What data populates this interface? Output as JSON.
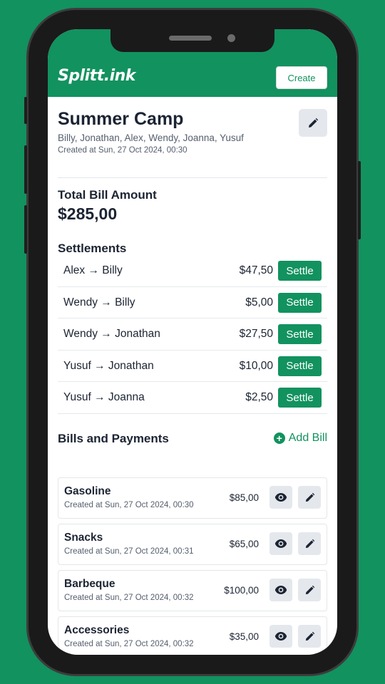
{
  "app": {
    "logo": "Splitt.ink",
    "create_label": "Create"
  },
  "group": {
    "title": "Summer Camp",
    "members": "Billy, Jonathan, Alex, Wendy, Joanna, Yusuf",
    "created": "Created at Sun, 27 Oct 2024, 00:30"
  },
  "total": {
    "label": "Total Bill Amount",
    "amount": "$285,00"
  },
  "settlements": {
    "heading": "Settlements",
    "button_label": "Settle",
    "arrow": "→",
    "items": [
      {
        "from": "Alex",
        "to": "Billy",
        "amount": "$47,50"
      },
      {
        "from": "Wendy",
        "to": "Billy",
        "amount": "$5,00"
      },
      {
        "from": "Wendy",
        "to": "Jonathan",
        "amount": "$27,50"
      },
      {
        "from": "Yusuf",
        "to": "Jonathan",
        "amount": "$10,00"
      },
      {
        "from": "Yusuf",
        "to": "Joanna",
        "amount": "$2,50"
      }
    ]
  },
  "bills": {
    "heading": "Bills and Payments",
    "add_label": "Add Bill",
    "items": [
      {
        "name": "Gasoline",
        "created": "Created at Sun, 27 Oct 2024, 00:30",
        "amount": "$85,00"
      },
      {
        "name": "Snacks",
        "created": "Created at Sun, 27 Oct 2024, 00:31",
        "amount": "$65,00"
      },
      {
        "name": "Barbeque",
        "created": "Created at Sun, 27 Oct 2024, 00:32",
        "amount": "$100,00"
      },
      {
        "name": "Accessories",
        "created": "Created at Sun, 27 Oct 2024, 00:32",
        "amount": "$35,00"
      }
    ]
  },
  "colors": {
    "brand": "#12925f",
    "text": "#1c2433",
    "muted": "#555f6d",
    "icon_bg": "#e4e8ed"
  }
}
